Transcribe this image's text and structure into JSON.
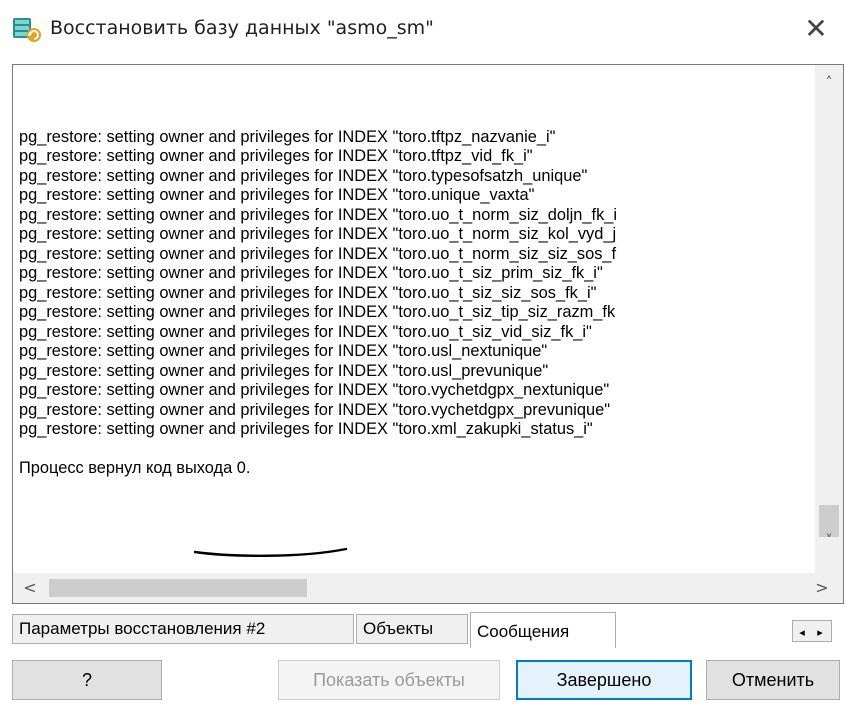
{
  "window": {
    "title": "Восстановить базу данных \"asmo_sm\"",
    "icon": "db-restore-icon",
    "close_glyph": "✕"
  },
  "log": {
    "lines": [
      "pg_restore: setting owner and privileges for INDEX \"toro.tftpz_nazvanie_i\"",
      "pg_restore: setting owner and privileges for INDEX \"toro.tftpz_vid_fk_i\"",
      "pg_restore: setting owner and privileges for INDEX \"toro.typesofsatzh_unique\"",
      "pg_restore: setting owner and privileges for INDEX \"toro.unique_vaxta\"",
      "pg_restore: setting owner and privileges for INDEX \"toro.uo_t_norm_siz_doljn_fk_i",
      "pg_restore: setting owner and privileges for INDEX \"toro.uo_t_norm_siz_kol_vyd_j",
      "pg_restore: setting owner and privileges for INDEX \"toro.uo_t_norm_siz_siz_sos_f",
      "pg_restore: setting owner and privileges for INDEX \"toro.uo_t_siz_prim_siz_fk_i\"",
      "pg_restore: setting owner and privileges for INDEX \"toro.uo_t_siz_siz_sos_fk_i\"",
      "pg_restore: setting owner and privileges for INDEX \"toro.uo_t_siz_tip_siz_razm_fk",
      "pg_restore: setting owner and privileges for INDEX \"toro.uo_t_siz_vid_siz_fk_i\"",
      "pg_restore: setting owner and privileges for INDEX \"toro.usl_nextunique\"",
      "pg_restore: setting owner and privileges for INDEX \"toro.usl_prevunique\"",
      "pg_restore: setting owner and privileges for INDEX \"toro.vychetdgpx_nextunique\"",
      "pg_restore: setting owner and privileges for INDEX \"toro.vychetdgpx_prevunique\"",
      "pg_restore: setting owner and privileges for INDEX \"toro.xml_zakupki_status_i\""
    ],
    "exit_message": "Процесс вернул код выхода 0."
  },
  "scrollbars": {
    "up": "˄",
    "down": "˅",
    "left": "<",
    "right": ">"
  },
  "tabs": [
    {
      "label": "Параметры восстановления #2"
    },
    {
      "label": "Объекты"
    },
    {
      "label": "Сообщения",
      "active": true
    }
  ],
  "tab_scroll": {
    "left": "◂",
    "right": "▸"
  },
  "buttons": {
    "help": "?",
    "show_objects": "Показать объекты",
    "done": "Завершено",
    "cancel": "Отменить"
  }
}
